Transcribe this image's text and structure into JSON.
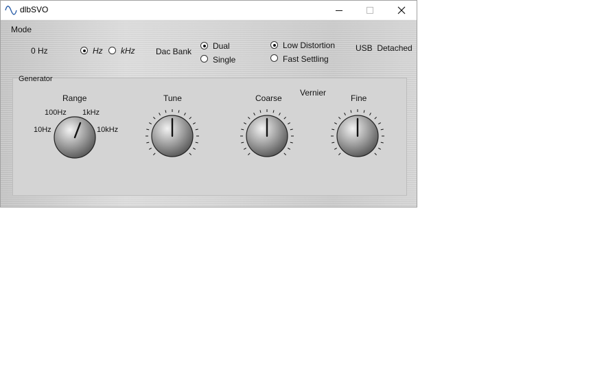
{
  "window": {
    "title": "dlbSVO"
  },
  "titlebar": {
    "minimize": "minimize",
    "maximize": "maximize",
    "close": "close"
  },
  "mode": {
    "menu_label": "Mode",
    "frequency": "0 Hz",
    "unit_options": [
      {
        "label": "Hz",
        "selected": true
      },
      {
        "label": "kHz",
        "selected": false
      }
    ],
    "dac_bank_label": "Dac Bank",
    "dac_bank_options": [
      {
        "label": "Dual",
        "selected": true
      },
      {
        "label": "Single",
        "selected": false
      }
    ],
    "settling_options": [
      {
        "label": "Low Distortion",
        "selected": true
      },
      {
        "label": "Fast Settling",
        "selected": false
      }
    ],
    "usb_status": "USB  Detached"
  },
  "generator": {
    "label": "Generator",
    "range": {
      "label": "Range",
      "positions": [
        "10Hz",
        "100Hz",
        "1kHz",
        "10kHz"
      ],
      "selected": "1kHz"
    },
    "tune": {
      "label": "Tune"
    },
    "vernier": {
      "label": "Vernier"
    },
    "coarse": {
      "label": "Coarse"
    },
    "fine": {
      "label": "Fine"
    }
  }
}
